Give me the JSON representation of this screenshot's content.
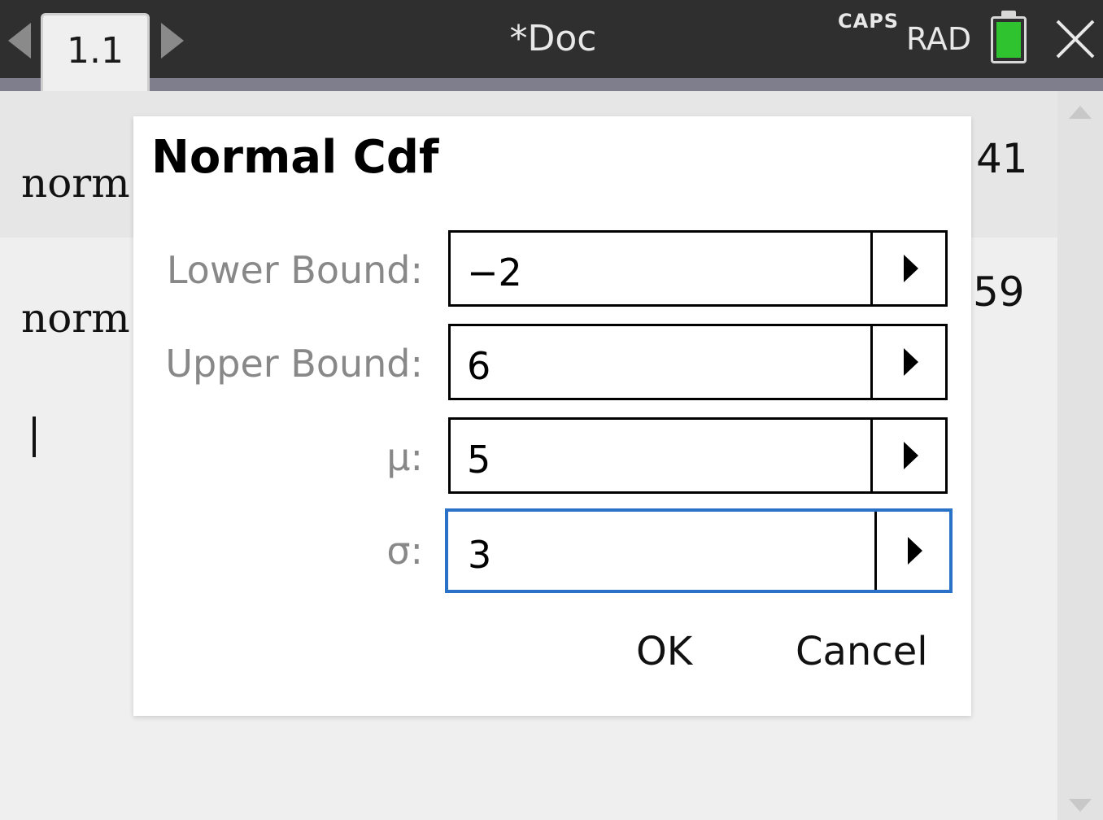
{
  "topbar": {
    "tab_label": "1.1",
    "doc_title": "*Doc",
    "caps": "CAPS",
    "angle_mode": "RAD",
    "battery_color": "#2fc42f"
  },
  "calculator": {
    "history": [
      {
        "expr": "norm",
        "result": "41"
      },
      {
        "expr": "norm",
        "result": "59"
      }
    ]
  },
  "dialog": {
    "title": "Normal Cdf",
    "fields": [
      {
        "label": "Lower Bound:",
        "value": "−2"
      },
      {
        "label": "Upper Bound:",
        "value": "6"
      },
      {
        "label": "μ:",
        "value": "5"
      },
      {
        "label": "σ:",
        "value": "3"
      }
    ],
    "ok_label": "OK",
    "cancel_label": "Cancel",
    "active_field_color": "#2a72c8"
  }
}
